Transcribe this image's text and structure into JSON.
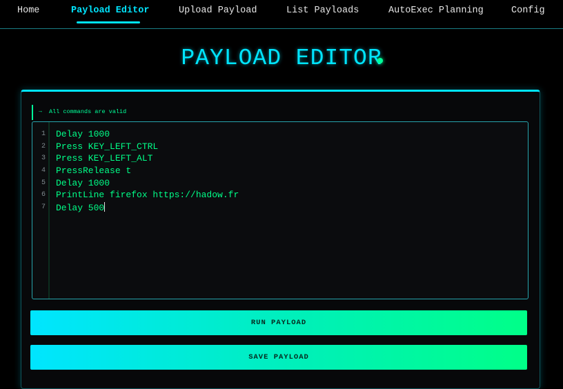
{
  "nav": {
    "items": [
      {
        "label": "Home",
        "active": false
      },
      {
        "label": "Payload Editor",
        "active": true
      },
      {
        "label": "Upload Payload",
        "active": false
      },
      {
        "label": "List Payloads",
        "active": false
      },
      {
        "label": "AutoExec Planning",
        "active": false
      },
      {
        "label": "Config",
        "active": false
      }
    ]
  },
  "page": {
    "title": "PAYLOAD EDITOR"
  },
  "validation": {
    "arrow": "→",
    "message": "All commands are valid",
    "status_color": "#00ff99"
  },
  "editor": {
    "lines": [
      {
        "no": "1",
        "text": "Delay 1000"
      },
      {
        "no": "2",
        "text": "Press KEY_LEFT_CTRL"
      },
      {
        "no": "3",
        "text": "Press KEY_LEFT_ALT"
      },
      {
        "no": "4",
        "text": "PressRelease t"
      },
      {
        "no": "5",
        "text": "Delay 1000"
      },
      {
        "no": "6",
        "text": "PrintLine firefox https://hadow.fr"
      },
      {
        "no": "7",
        "text": "Delay 500"
      }
    ]
  },
  "buttons": {
    "run_label": "RUN PAYLOAD",
    "save_label": "SAVE PAYLOAD"
  },
  "colors": {
    "accent": "#00e5ff",
    "code_green": "#00ff88"
  }
}
